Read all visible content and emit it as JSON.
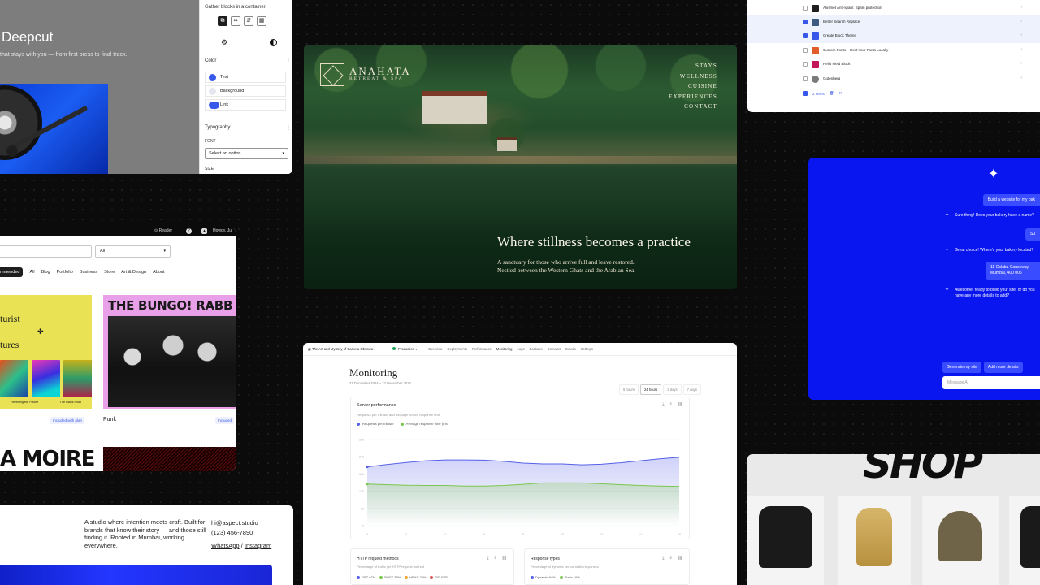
{
  "editor": {
    "site_title": "Deepcut",
    "tagline": "that stays with you — from first press to final track.",
    "hint": "Gather blocks in a container.",
    "color_heading": "Color",
    "colors": [
      {
        "label": "Text",
        "swatch": "#3858e9"
      },
      {
        "label": "Background",
        "swatch": "#e6e6ef"
      },
      {
        "label": "Link",
        "swatch": "#3858e9"
      }
    ],
    "typography_heading": "Typography",
    "font_label": "FONT",
    "font_select": "Select an option",
    "size_label": "SIZE"
  },
  "hero": {
    "brand": "ANAHATA",
    "brand_sub": "RETREAT & SPA",
    "nav": [
      "STAYS",
      "WELLNESS",
      "CUISINE",
      "EXPERIENCES",
      "CONTACT"
    ],
    "headline": "Where stillness becomes a practice",
    "sub_line1": "A sanctuary for those who arrive full and leave restored.",
    "sub_line2": "Nestled between the Western Ghats and the Arabian Sea."
  },
  "tasks": {
    "rows": [
      {
        "label": "Akismet Anti-spam: Spam protection",
        "checked": false,
        "color": "#1e1e1e",
        "highlight": false
      },
      {
        "label": "Better Search Replace",
        "checked": true,
        "color": "#3d5a80",
        "highlight": true
      },
      {
        "label": "Create Block Theme",
        "checked": true,
        "color": "#3858e9",
        "highlight": true
      },
      {
        "label": "Custom Fonts – Host Your Fonts Locally",
        "checked": false,
        "color": "#e25d2b",
        "highlight": false
      },
      {
        "label": "Hello Field Block",
        "checked": false,
        "color": "#c2185b",
        "highlight": false
      },
      {
        "label": "Gutenberg",
        "checked": false,
        "color": "#7a7a7a",
        "highlight": false
      }
    ],
    "footer": "2 Items"
  },
  "directory": {
    "reader": "Reader",
    "user": "Howdy, Ju",
    "filter": "All",
    "categories": [
      "mmended",
      "All",
      "Blog",
      "Portfolio",
      "Business",
      "Store",
      "Art & Design",
      "About"
    ],
    "card1_line1": "turist",
    "card1_line2": "tures",
    "card1_glyph": "✤",
    "card1_caps": [
      "Revelling the Future",
      "The Black Fluid"
    ],
    "card2_title": "THE BUNGO! RABB",
    "included1": "Included with plan",
    "theme_name": "Punk",
    "included2": "Included",
    "moire": "A MOIRE"
  },
  "monitoring": {
    "site": "The Art and Mystery of Camera Obscura",
    "env": "Production",
    "tabs": [
      "Overview",
      "Deployments",
      "Performance",
      "Monitoring",
      "Logs",
      "Backups",
      "Domains",
      "Emails",
      "Settings"
    ],
    "active_tab": "Monitoring",
    "title": "Monitoring",
    "date_range": "21 December 2024 – 22 December 2024",
    "ranges": [
      "6 hours",
      "24 hours",
      "3 days",
      "7 days"
    ],
    "active_range": "24 hours",
    "card_title": "Server performance",
    "card_desc": "Requests per minute and average server response time",
    "mini1_title": "HTTP request methods",
    "mini1_desc": "Percentage of traffic per HTTP request method",
    "mini1_legend": [
      "GET 67%",
      "POST 33%",
      "HEAD 28%",
      "DELETE"
    ],
    "mini2_title": "Response types",
    "mini2_desc": "Percentage of dynamic versus static responses",
    "mini2_legend": [
      "Dynamic 84%",
      "Static 16%"
    ]
  },
  "chart_data": {
    "type": "area",
    "title": "Server performance",
    "xlabel": "",
    "ylabel": "",
    "x": [
      0,
      1,
      2,
      3,
      4,
      5,
      6,
      7,
      8,
      9,
      10,
      11,
      12,
      13,
      14,
      15,
      16
    ],
    "series": [
      {
        "name": "Requests per minute",
        "color": "#5660e8",
        "values": [
          205,
          213,
          220,
          226,
          229,
          229,
          228,
          224,
          218,
          215,
          215,
          212,
          214,
          219,
          226,
          233,
          238
        ]
      },
      {
        "name": "Average response time (ms)",
        "color": "#7bc74d",
        "values": [
          145,
          143,
          141,
          140,
          140,
          138,
          138,
          140,
          144,
          149,
          149,
          149,
          146,
          143,
          140,
          138,
          137
        ]
      }
    ],
    "ylim": [
      0,
      300
    ],
    "grid": true,
    "legend": "top-left"
  },
  "chat": {
    "messages": [
      {
        "role": "user",
        "text": "Build a website for my bak"
      },
      {
        "role": "assistant",
        "text": "Sure thing! Does your bakery have a name?"
      },
      {
        "role": "user",
        "text": "Su"
      },
      {
        "role": "assistant",
        "text": "Great choice! Where's your bakery located?"
      },
      {
        "role": "user",
        "text": "11 Colaba Causeway, Mumbai, 400 005"
      },
      {
        "role": "assistant",
        "text": "Awesome, ready to build your site, or do you have any more details to add?"
      }
    ],
    "btn_generate": "Generate my site",
    "btn_more": "Add more details",
    "input_placeholder": "Message AI"
  },
  "studio": {
    "blurb": "A studio where intention meets craft. Built for brands that know their story — and those still finding it. Rooted in Mumbai, working everywhere.",
    "email": "hi@aspect.studio",
    "phone": "(123) 456-7890",
    "social1": "WhatsApp",
    "social2": "Instagram"
  },
  "shop": {
    "brand": "SHOP",
    "items": [
      "jacket",
      "backpack",
      "beanie",
      "jacket"
    ]
  }
}
